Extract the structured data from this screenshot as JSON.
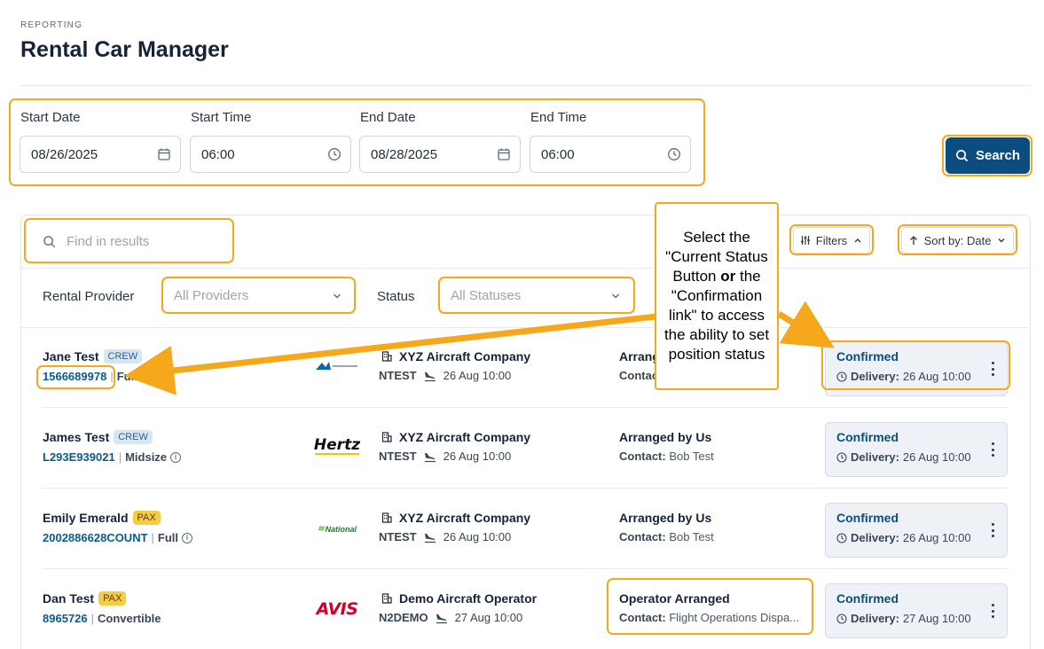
{
  "header": {
    "eyebrow": "REPORTING",
    "title": "Rental Car Manager"
  },
  "filters": {
    "start_date_label": "Start Date",
    "start_date": "08/26/2025",
    "start_time_label": "Start Time",
    "start_time": "06:00",
    "end_date_label": "End Date",
    "end_date": "08/28/2025",
    "end_time_label": "End Time",
    "end_time": "06:00",
    "search_label": "Search"
  },
  "toolbar": {
    "find_placeholder": "Find in results",
    "filters_label": "Filters",
    "sort_label": "Sort by: Date"
  },
  "selects": {
    "provider_label": "Rental Provider",
    "provider_value": "All Providers",
    "status_label": "Status",
    "status_value": "All Statuses"
  },
  "rows": [
    {
      "name": "Jane Test",
      "badge": "CREW",
      "confirmation": "1566689978",
      "car_class": "Full",
      "logo": "alamo",
      "company": "XYZ Aircraft Company",
      "tail": "NTEST",
      "flight_time": "26 Aug 10:00",
      "arranged": "Arrang",
      "contact_label": "Contact:",
      "contact": "",
      "status": "Confirmed",
      "delivery_label": "Delivery:",
      "delivery": "26 Aug 10:00"
    },
    {
      "name": "James Test",
      "badge": "CREW",
      "confirmation": "L293E939021",
      "car_class": "Midsize",
      "logo": "Hertz",
      "company": "XYZ Aircraft Company",
      "tail": "NTEST",
      "flight_time": "26 Aug 10:00",
      "arranged": "Arranged by Us",
      "contact_label": "Contact:",
      "contact": "Bob Test",
      "status": "Confirmed",
      "delivery_label": "Delivery:",
      "delivery": "26 Aug 10:00"
    },
    {
      "name": "Emily Emerald",
      "badge": "PAX",
      "confirmation": "2002886628COUNT",
      "car_class": "Full",
      "logo": "National",
      "company": "XYZ Aircraft Company",
      "tail": "NTEST",
      "flight_time": "26 Aug 10:00",
      "arranged": "Arranged by Us",
      "contact_label": "Contact:",
      "contact": "Bob Test",
      "status": "Confirmed",
      "delivery_label": "Delivery:",
      "delivery": "26 Aug 10:00"
    },
    {
      "name": "Dan Test",
      "badge": "PAX",
      "confirmation": "8965726",
      "car_class": "Convertible",
      "logo": "AVIS",
      "company": "Demo Aircraft Operator",
      "tail": "N2DEMO",
      "flight_time": "27 Aug 10:00",
      "arranged": "Operator Arranged",
      "contact_label": "Contact:",
      "contact": "Flight Operations Dispa...",
      "status": "Confirmed",
      "delivery_label": "Delivery:",
      "delivery": "27 Aug 10:00"
    }
  ],
  "callout": {
    "line1": "Select the \"Current Status Button",
    "or": "or",
    "line2": "the \"Confirmation link\" to access the ability to set position status"
  },
  "colors": {
    "accent": "#f5a81c",
    "primary": "#0a4d7e",
    "link": "#0a5b8e"
  }
}
